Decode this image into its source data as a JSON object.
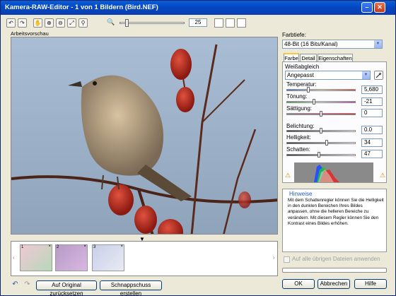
{
  "window": {
    "title": "Kamera-RAW-Editor - 1 von 1 Bildern (Bird.NEF)",
    "minimize_glyph": "–",
    "close_glyph": "✕"
  },
  "toolbar": {
    "tools": [
      {
        "name": "rotate-left-icon",
        "glyph": "↶"
      },
      {
        "name": "rotate-right-icon",
        "glyph": "↷"
      },
      {
        "name": "hand-icon",
        "glyph": "✋"
      },
      {
        "name": "zoom-in-icon",
        "glyph": "⊕"
      },
      {
        "name": "zoom-out-icon",
        "glyph": "⊖"
      },
      {
        "name": "fit-icon",
        "glyph": "⤢"
      },
      {
        "name": "eyedropper-icon",
        "glyph": "⚲"
      }
    ],
    "zoom_glyph": "🔍",
    "zoom_value": "25"
  },
  "preview": {
    "label": "Arbeitsvorschau",
    "down_arrow": "▼"
  },
  "filmstrip": {
    "left_arrow": "‹",
    "right_arrow": "›",
    "thumbs": [
      {
        "num": "1",
        "x": "×"
      },
      {
        "num": "2",
        "x": "×"
      },
      {
        "num": "3",
        "x": "×"
      }
    ]
  },
  "bottom": {
    "undo_glyph": "↶",
    "redo_glyph": "↷",
    "reset_label": "Auf Original zurücksetzen",
    "snapshot_label": "Schnappschuss erstellen",
    "ok_label": "OK",
    "cancel_label": "Abbrechen",
    "help_label": "Hilfe"
  },
  "panel": {
    "depth_label": "Farbtiefe:",
    "depth_value": "48-Bit (16 Bits/Kanal)",
    "tabs": [
      "Farbe",
      "Detail",
      "Eigenschaften"
    ],
    "wb_label": "Weißabgleich",
    "wb_value": "Angepasst",
    "select_arrow": "▼",
    "sliders": [
      {
        "label": "Temperatur:",
        "value": "5,680"
      },
      {
        "label": "Tönung:",
        "value": "-21"
      },
      {
        "label": "Sättigung:",
        "value": "0"
      },
      {
        "label": "Belichtung:",
        "value": "0.0"
      },
      {
        "label": "Helligkeit:",
        "value": "34"
      },
      {
        "label": "Schatten:",
        "value": "47"
      }
    ],
    "warn_glyph": "⚠",
    "hints_title": "Hinweise",
    "hints_text": "Mit dem Schattenregler können Sie die Helligkeit in den dunklen Bereichen Ihres Bildes anpassen, ohne die helleren Bereiche zu verändern. Mit diesem Regler können Sie den Kontrast eines Bildes erhöhen.",
    "apply_all_label": "Auf alle übrigen Dateien anwenden"
  }
}
